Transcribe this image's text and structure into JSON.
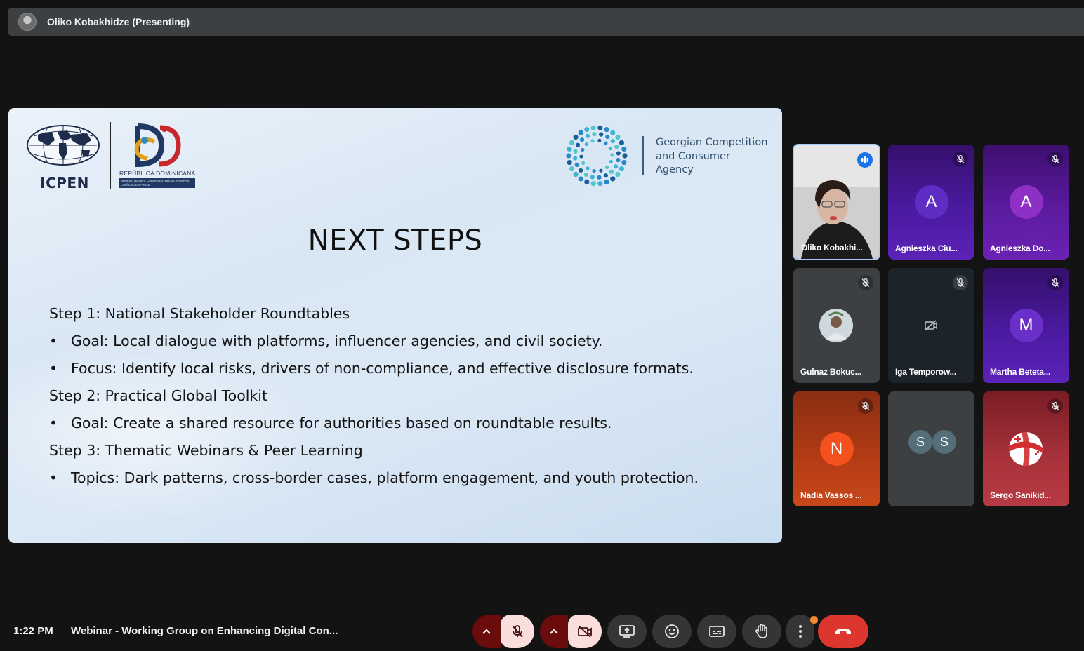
{
  "topbar": {
    "presenter": "Oliko Kobakhidze (Presenting)"
  },
  "slide": {
    "icpen_label": "ICPEN",
    "dr_label": "REPÚBLICA DOMINICANA",
    "dr_tagline": "Breaking Borders, Connecting Nations, Resolving Conflicts 2025–2026",
    "gcca_lines": [
      "Georgian Competition",
      "and Consumer",
      "Agency"
    ],
    "title": "NEXT STEPS",
    "lines": [
      {
        "text": "Step 1: National Stakeholder Roundtables",
        "bullet": false
      },
      {
        "text": "Goal: Local dialogue with platforms, influencer agencies, and civil society.",
        "bullet": true
      },
      {
        "text": "Focus: Identify local risks, drivers of non-compliance, and effective disclosure formats.",
        "bullet": true
      },
      {
        "text": "Step 2: Practical Global Toolkit",
        "bullet": false
      },
      {
        "text": "Goal: Create a shared resource for authorities based on roundtable results.",
        "bullet": true
      },
      {
        "text": "Step 3: Thematic Webinars & Peer Learning",
        "bullet": false
      },
      {
        "text": "Topics: Dark patterns, cross-border cases, platform engagement, and youth protection.",
        "bullet": true
      }
    ],
    "bullet_char": "•"
  },
  "participants": [
    {
      "name": "Oliko Kobakhi...",
      "letter": "",
      "status": "speaking"
    },
    {
      "name": "Agnieszka Ciu...",
      "letter": "A",
      "status": "muted"
    },
    {
      "name": "Agnieszka Do...",
      "letter": "A",
      "status": "muted"
    },
    {
      "name": "Gulnaz Bokuc...",
      "letter": "",
      "status": "muted"
    },
    {
      "name": "Iga Temporow...",
      "letter": "",
      "status": "muted"
    },
    {
      "name": "Martha Beteta...",
      "letter": "M",
      "status": "muted"
    },
    {
      "name": "Nadia Vassos ...",
      "letter": "N",
      "status": "muted"
    },
    {
      "name": "",
      "letters": [
        "S",
        "S"
      ],
      "status": "none"
    },
    {
      "name": "Sergo Sanikid...",
      "letter": "",
      "status": "muted"
    }
  ],
  "bottom": {
    "time": "1:22 PM",
    "meeting_title": "Webinar - Working Group on Enhancing Digital Con..."
  },
  "colors": {
    "hangup": "#dc362e",
    "muted_bg": "#f9dedc",
    "accent_dot": "#f28b2b"
  }
}
